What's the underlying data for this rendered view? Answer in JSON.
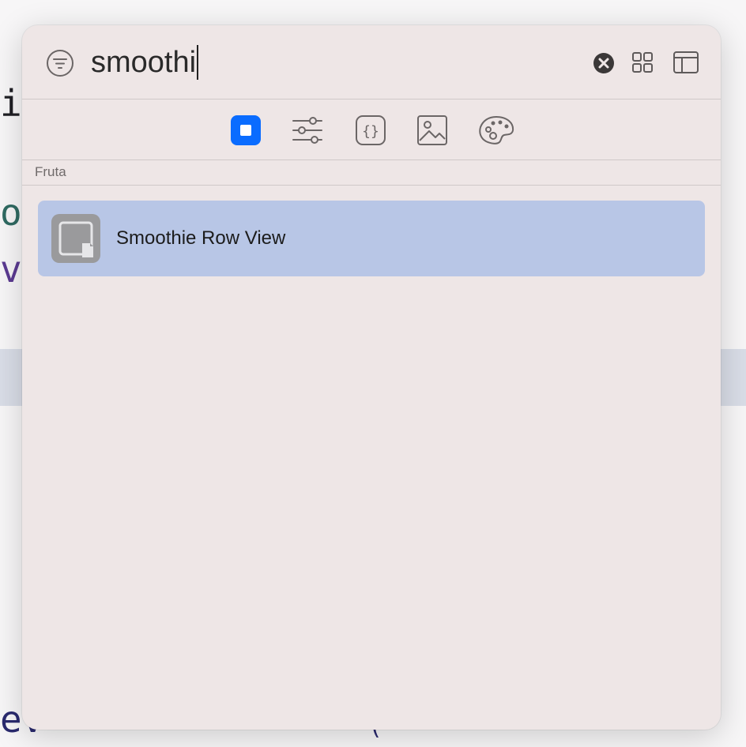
{
  "search": {
    "query": "smoothi"
  },
  "icons": {
    "filter": "filter-circle-icon",
    "clear": "clear-x-circle-icon",
    "grid_view": "grid-view-icon",
    "sidebar": "sidebar-panel-icon",
    "categories": [
      "views-square-icon",
      "modifiers-sliders-icon",
      "snippets-braces-icon",
      "media-image-icon",
      "colors-palette-icon"
    ],
    "result": "swiftui-view-file-icon"
  },
  "colors": {
    "accent": "#0a6cff",
    "selected_row": "#b8c6e6",
    "panel": "#eee6e6"
  },
  "results": {
    "section_title": "Fruta",
    "items": [
      {
        "label": "Smoothie Row View"
      }
    ]
  },
  "background_code": {
    "fragments": [
      "ie",
      "o",
      "v:",
      "ev",
      "("
    ]
  }
}
